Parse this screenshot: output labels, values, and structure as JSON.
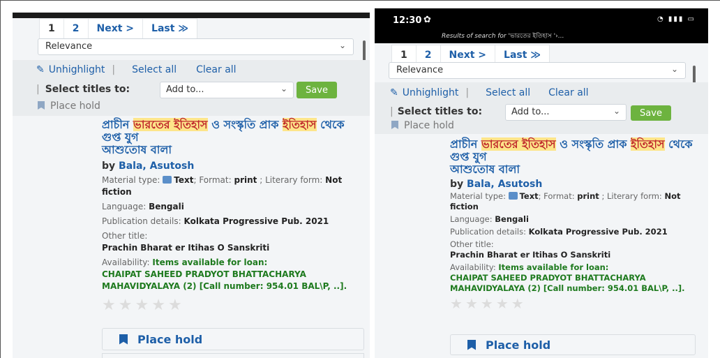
{
  "pager": {
    "pages": [
      "1",
      "2"
    ],
    "next": "Next >",
    "last": "Last ≫"
  },
  "sort": {
    "selected": "Relevance"
  },
  "toolbar": {
    "unhighlight": "Unhighlight",
    "select_all": "Select all",
    "clear_all": "Clear all",
    "select_titles_label": "Select titles to:",
    "add_to": "Add to...",
    "save": "Save",
    "place_hold": "Place hold"
  },
  "status_bar": {
    "time": "12:30",
    "subtitle_prefix": "Results of search for",
    "subtitle_query": "'ভারতের ইতিহাস '›..."
  },
  "record": {
    "title_part1": "প্রাচীন ",
    "title_hl1": "ভারতের ইতিহাস",
    "title_part2": " ও সংস্কৃতি প্রাক ",
    "title_hl2": "ইতিহাস",
    "title_part3": " থেকে গুপ্ত যুগ",
    "title_line3": "আশুতোষ বালা",
    "by": "by",
    "author": "Bala, Asutosh",
    "material_type_label": "Material type:",
    "material_type": "Text",
    "format_label": "; Format:",
    "format": "print",
    "literary_label": "; Literary form:",
    "literary_form": "Not fiction",
    "language_label": "Language:",
    "language": "Bengali",
    "publication_label": "Publication details:",
    "publication": "Kolkata Progressive Pub. 2021",
    "other_title_label": "Other title:",
    "other_title": "Prachin Bharat er Itihas O Sanskriti",
    "availability_label": "Availability:",
    "availability": "Items available for loan:",
    "availability_detail": "CHAIPAT SAHEED PRADYOT BHATTACHARYA MAHAVIDYALAYA (2) [Call number: 954.01 BAL\\P, ..].",
    "rating_stars": 0,
    "place_hold_button": "Place hold"
  },
  "icons": {
    "pencil": "pencil-icon",
    "bookmark": "bookmark-icon",
    "star": "star-icon",
    "text_type": "text-document-icon"
  },
  "colors": {
    "link": "#1e5fa8",
    "highlight_bg": "#fde58a",
    "highlight_text": "#c0282c",
    "save_button": "#6db33f",
    "availability": "#1e7a1e"
  }
}
